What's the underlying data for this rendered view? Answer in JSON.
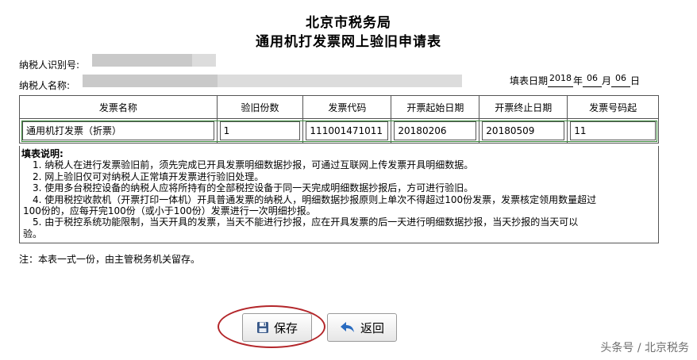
{
  "header": {
    "title_line1": "北京市税务局",
    "title_line2": "通用机打发票网上验旧申请表"
  },
  "taxpayer": {
    "id_label": "纳税人识别号:",
    "name_label": "纳税人名称:"
  },
  "fill_date": {
    "label": "填表日期",
    "year": "2018",
    "year_unit": "年",
    "month": "06",
    "month_unit": "月",
    "day": "06",
    "day_unit": "日"
  },
  "table": {
    "headers": [
      "发票名称",
      "验旧份数",
      "发票代码",
      "开票起始日期",
      "开票终止日期",
      "发票号码起"
    ],
    "rows": [
      [
        "通用机打发票（折票）",
        "1",
        "111001471011",
        "20180206",
        "20180509",
        "11"
      ]
    ]
  },
  "instructions": {
    "heading": "填表说明:",
    "items": [
      "1. 纳税人在进行发票验旧前，须先完成已开具发票明细数据抄报，可通过互联网上传发票开具明细数据。",
      "2. 网上验旧仅可对纳税人正常填开发票进行验旧处理。",
      "3. 使用多台税控设备的纳税人应将所持有的全部税控设备于同一天完成明细数据抄报后，方可进行验旧。",
      "4. 使用税控收款机（开票打印一体机）开具普通发票的纳税人，明细数据抄报原则上单次不得超过100份发票，发票核定领用数量超过",
      "100份的，应每开完100份（或小于100份）发票进行一次明细抄报。",
      "5. 由于税控系统功能限制，当天开具的发票，当天不能进行抄报，应在开具发票的后一天进行明细数据抄报，当天抄报的当天可以",
      "验。"
    ]
  },
  "footer_note": "注：本表一式一份，由主管税务机关留存。",
  "buttons": {
    "save": "保存",
    "back": "返回"
  },
  "watermark": "头条号 / 北京税务",
  "colors": {
    "highlight_ring": "#b3262a",
    "row_border": "#3a8a3a",
    "save_icon": "#3a5a8a",
    "back_icon": "#2a6cc0"
  }
}
